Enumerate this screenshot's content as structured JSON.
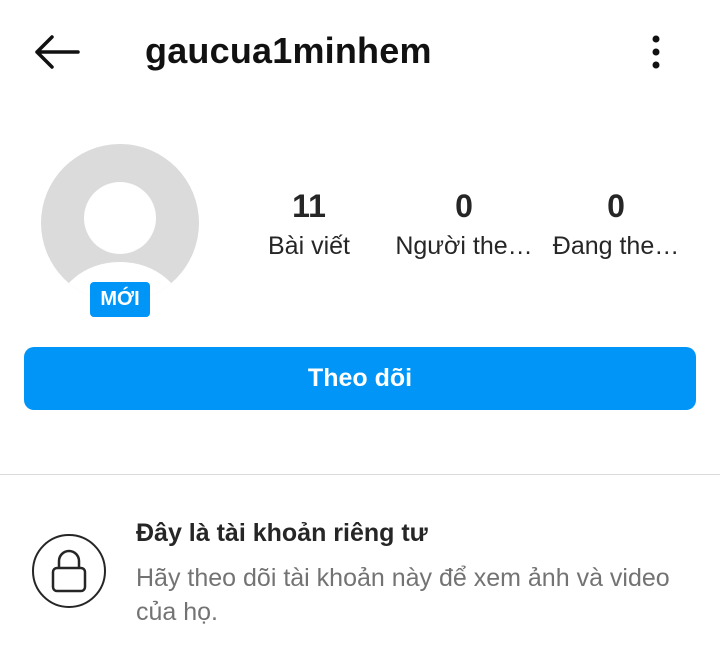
{
  "header": {
    "username": "gaucua1minhem",
    "back_icon": "arrow-left-icon",
    "more_icon": "more-vertical-icon"
  },
  "profile": {
    "avatar_icon": "default-avatar-icon",
    "new_badge": "MỚI",
    "stats": {
      "posts": {
        "count": "11",
        "label": "Bài viết"
      },
      "followers": {
        "count": "0",
        "label": "Người the…"
      },
      "following": {
        "count": "0",
        "label": "Đang the…"
      }
    },
    "follow_button": "Theo dõi"
  },
  "private_notice": {
    "icon": "lock-icon",
    "title": "Đây là tài khoản riêng tư",
    "description": "Hãy theo dõi tài khoản này để xem ảnh và video của họ."
  },
  "colors": {
    "accent": "#0095f6",
    "text": "#262626",
    "secondary_text": "#737373",
    "avatar_bg": "#dbdbdb"
  }
}
